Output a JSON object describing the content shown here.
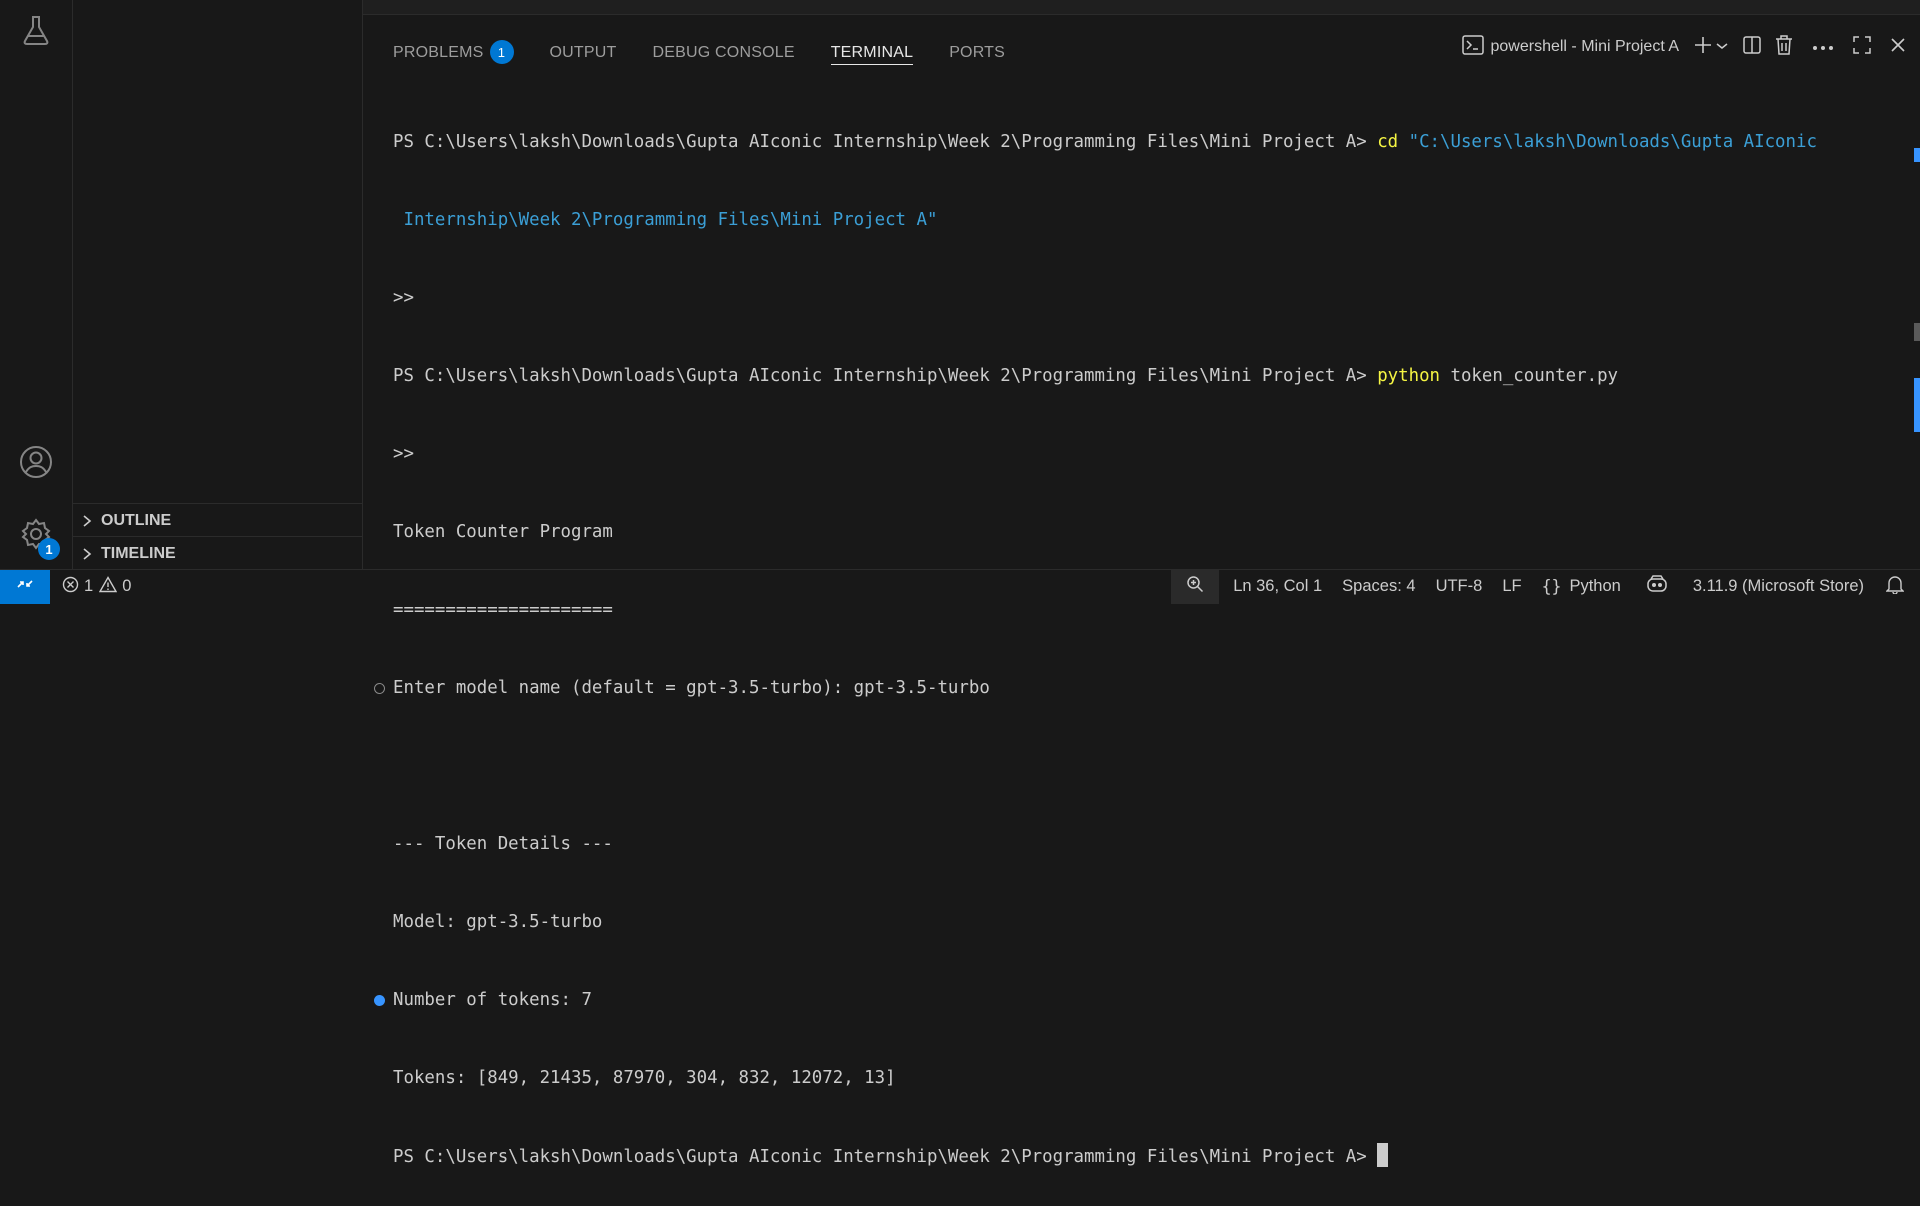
{
  "activity": {
    "accounts_badge": "",
    "manage_badge": "1"
  },
  "sidebar": {
    "outline_label": "OUTLINE",
    "timeline_label": "TIMELINE"
  },
  "panel": {
    "tabs": [
      {
        "label": "PROBLEMS",
        "badge": "1"
      },
      {
        "label": "OUTPUT"
      },
      {
        "label": "DEBUG CONSOLE"
      },
      {
        "label": "TERMINAL",
        "active": true
      },
      {
        "label": "PORTS"
      }
    ],
    "terminal_name": "powershell - Mini Project A"
  },
  "terminal": {
    "prompt": "PS C:\\Users\\laksh\\Downloads\\Gupta AIconic Internship\\Week 2\\Programming Files\\Mini Project A> ",
    "cmd1_keyword": "cd",
    "cmd1_arg_line1": " \"C:\\Users\\laksh\\Downloads\\Gupta AIconic",
    "cmd1_arg_line2": " Internship\\Week 2\\Programming Files\\Mini Project A\"",
    "continuation": ">>",
    "cmd2_keyword": "python",
    "cmd2_arg": " token_counter.py",
    "out_title": "Token Counter Program",
    "out_rule": "=====================",
    "out_prompt_model": "Enter model name (default = gpt-3.5-turbo): gpt-3.5-turbo",
    "out_blank": "",
    "out_details_header": "--- Token Details ---",
    "out_model": "Model: gpt-3.5-turbo",
    "out_count": "Number of tokens: 7",
    "out_tokens": "Tokens: [849, 21435, 87970, 304, 832, 12072, 13]"
  },
  "status": {
    "errors": "1",
    "warnings": "0",
    "position": "Ln 36, Col 1",
    "spaces": "Spaces: 4",
    "encoding": "UTF-8",
    "eol": "LF",
    "language": "Python",
    "interpreter": "3.11.9 (Microsoft Store)"
  },
  "colors": {
    "accent": "#0078d4",
    "keyword": "#f5f543",
    "string": "#3b9fd6"
  }
}
